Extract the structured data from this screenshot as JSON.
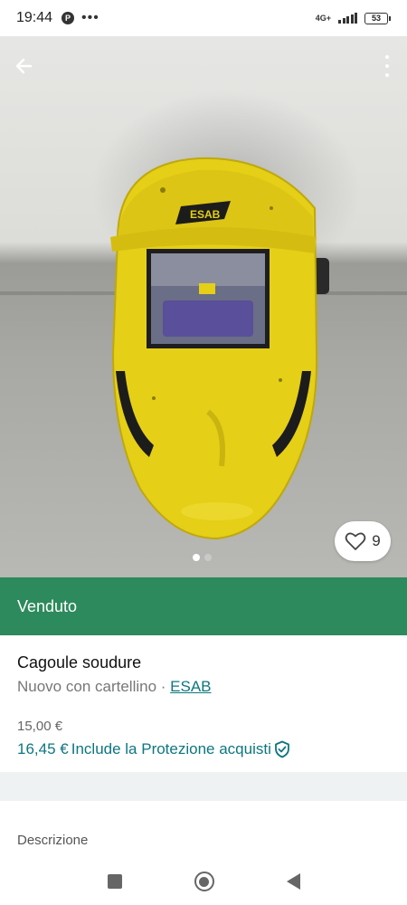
{
  "status_bar": {
    "time": "19:44",
    "notification_icon": "P",
    "more_dots": "•••",
    "network_type": "4G+",
    "battery": "53"
  },
  "photo": {
    "like_count": "9",
    "page_indicator": {
      "count": 2,
      "active_index": 0
    },
    "helmet_brand_mark": "ESAB"
  },
  "banner": {
    "label": "Venduto"
  },
  "listing": {
    "title": "Cagoule soudure",
    "condition": "Nuovo con cartellino · ",
    "brand": "ESAB",
    "price": "15,00 €",
    "price_with_protection": "16,45 €",
    "protection_label": "Include la Protezione acquisti"
  },
  "description": {
    "label": "Descrizione"
  },
  "colors": {
    "sold_green": "#2d8a5c",
    "link_teal": "#0d7680",
    "helmet_yellow": "#e8d21a"
  }
}
